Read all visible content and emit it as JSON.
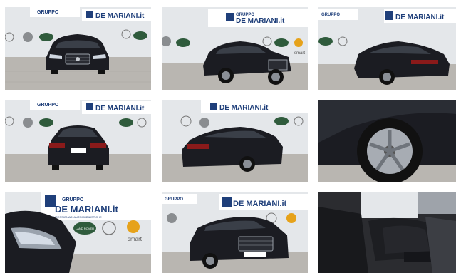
{
  "gallery": {
    "dealer": {
      "line1": "GRUPPO",
      "line2": "DE MARIANI.it",
      "tagline": "CONCESSIONARI AUTOMOBILISTICHE"
    },
    "brands": [
      "mercedes-logo",
      "volvo-logo",
      "land-rover-logo",
      "opel-logo",
      "smart-logo"
    ],
    "brand_labels": {
      "land_rover": "LAND ROVER",
      "smart": "smart"
    },
    "colors": {
      "car_body": "#1b1c22",
      "floor": "#b9b6b1",
      "wall": "#e4e7ea",
      "banner_blue": "#1f3f7a",
      "land_rover_green": "#2f5b3c"
    },
    "photos": [
      {
        "view": "front"
      },
      {
        "view": "front-three-quarter-left"
      },
      {
        "view": "rear-three-quarter-left"
      },
      {
        "view": "rear"
      },
      {
        "view": "rear-three-quarter-right"
      },
      {
        "view": "wheel-detail"
      },
      {
        "view": "headlight-detail"
      },
      {
        "view": "front-three-quarter-low"
      },
      {
        "view": "rear-seats-interior"
      }
    ]
  }
}
